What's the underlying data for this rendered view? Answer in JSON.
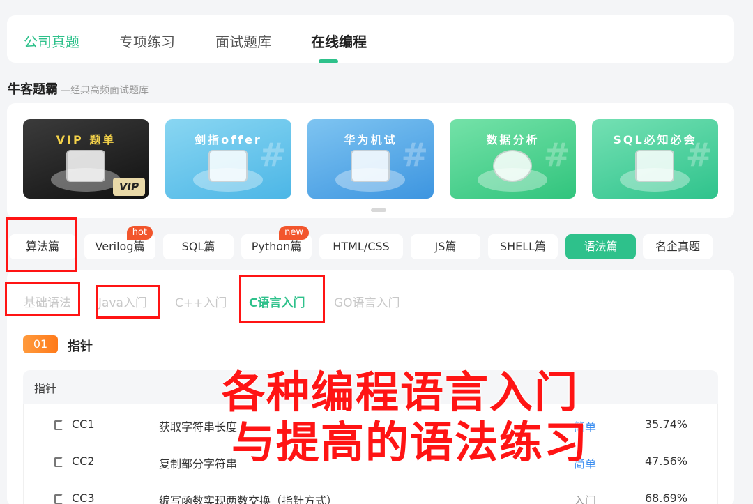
{
  "top_tabs": [
    "公司真题",
    "专项练习",
    "面试题库",
    "在线编程"
  ],
  "heading": {
    "title": "牛客题霸",
    "subtitle": "—经典高频面试题库"
  },
  "banners": [
    {
      "title": "VIP 题单",
      "badge": "VIP"
    },
    {
      "title": "剑指offer"
    },
    {
      "title": "华为机试"
    },
    {
      "title": "数据分析"
    },
    {
      "title": "SQL必知必会"
    }
  ],
  "categories": [
    {
      "label": "算法篇"
    },
    {
      "label": "Verilog篇",
      "tag": "hot"
    },
    {
      "label": "SQL篇"
    },
    {
      "label": "Python篇",
      "tag": "new"
    },
    {
      "label": "HTML/CSS"
    },
    {
      "label": "JS篇"
    },
    {
      "label": "SHELL篇"
    },
    {
      "label": "语法篇",
      "active": true
    },
    {
      "label": "名企真题"
    }
  ],
  "sub_tabs": [
    {
      "label": "基础语法"
    },
    {
      "label": "Java入门"
    },
    {
      "label": "C++入门"
    },
    {
      "label": "C语言入门",
      "active": true
    },
    {
      "label": "GO语言入门"
    }
  ],
  "section": {
    "number": "01",
    "title": "指针"
  },
  "table": {
    "header": "指针",
    "rows": [
      {
        "id": "CC1",
        "name": "获取字符串长度",
        "difficulty": "简单",
        "rate": "35.74%"
      },
      {
        "id": "CC2",
        "name": "复制部分字符串",
        "difficulty": "简单",
        "rate": "47.56%"
      },
      {
        "id": "CC3",
        "name": "编写函数实现两数交换（指针方式）",
        "difficulty": "入门",
        "rate": "68.69%"
      }
    ]
  },
  "overlay": {
    "line1": "各种编程语言入门",
    "line2": "与提高的语法练习"
  },
  "colors": {
    "brand_green": "#2ec18b",
    "annotation_red": "#ff1414",
    "tag_red": "#f2552c",
    "section_orange": "#ff8a2a",
    "link_blue": "#3a8df0"
  }
}
